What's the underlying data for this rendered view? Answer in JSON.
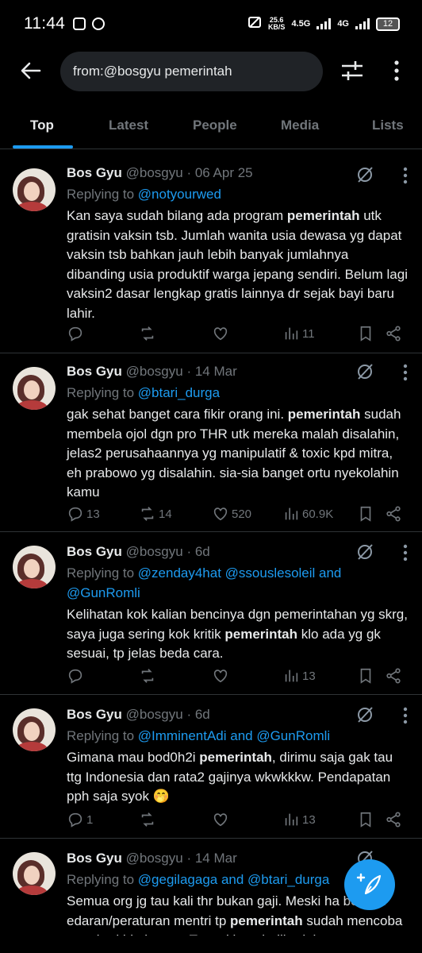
{
  "status_bar": {
    "time": "11:44",
    "net_speed_value": "25.6",
    "net_speed_unit": "KB/S",
    "net_label_1": "4.5G",
    "net_label_2": "4G",
    "battery": "12"
  },
  "header": {
    "search_query": "from:@bosgyu pemerintah"
  },
  "tabs": [
    {
      "label": "Top",
      "active": true
    },
    {
      "label": "Latest"
    },
    {
      "label": "People"
    },
    {
      "label": "Media"
    },
    {
      "label": "Lists"
    }
  ],
  "tweets": [
    {
      "name": "Bos Gyu",
      "handle": "@bosgyu",
      "date": "· 06 Apr 25",
      "reply_prefix": "Replying to ",
      "reply_to": "@notyourwed",
      "text_before": "Kan saya sudah bilang ada program ",
      "highlight": "pemerintah",
      "text_after": " utk gratisin vaksin tsb. Jumlah wanita usia dewasa yg dapat vaksin tsb bahkan jauh lebih banyak jumlahnya dibanding usia produktif warga jepang sendiri. Belum lagi vaksin2 dasar lengkap gratis lainnya dr sejak bayi baru lahir.",
      "replies": "",
      "retweets": "",
      "likes": "",
      "views": "11"
    },
    {
      "name": "Bos Gyu",
      "handle": "@bosgyu",
      "date": "· 14 Mar",
      "reply_prefix": "Replying to ",
      "reply_to": "@btari_durga",
      "text_before": "gak sehat banget cara fikir orang ini. ",
      "highlight": "pemerintah",
      "text_after": " sudah membela ojol dgn pro THR utk mereka malah disalahin, jelas2 perusahaannya yg manipulatif & toxic kpd mitra, eh prabowo yg disalahin. sia-sia banget ortu nyekolahin kamu",
      "replies": "13",
      "retweets": "14",
      "likes": "520",
      "views": "60.9K"
    },
    {
      "name": "Bos Gyu",
      "handle": "@bosgyu",
      "date": "· 6d",
      "reply_prefix": "Replying to ",
      "reply_to": "@zenday4hat @ssouslesoleil and @GunRomli",
      "text_before": "Kelihatan kok kalian bencinya dgn pemerintahan yg skrg, saya juga sering kok kritik ",
      "highlight": "pemerintah",
      "text_after": " klo ada yg gk sesuai, tp jelas beda cara.",
      "replies": "",
      "retweets": "",
      "likes": "",
      "views": "13"
    },
    {
      "name": "Bos Gyu",
      "handle": "@bosgyu",
      "date": "· 6d",
      "reply_prefix": "Replying to ",
      "reply_to": "@ImminentAdi and @GunRomli",
      "text_before": "Gimana mau bod0h2i ",
      "highlight": "pemerintah",
      "text_after": ", dirimu saja gak tau ttg Indonesia dan rata2 gajinya wkwkkkw. Pendapatan pph saja syok 🤭",
      "replies": "1",
      "retweets": "",
      "likes": "",
      "views": "13"
    },
    {
      "name": "Bos Gyu",
      "handle": "@bosgyu",
      "date": "· 14 Mar",
      "reply_prefix": "Replying to ",
      "reply_to": "@gegilagaga and @btari_durga",
      "text_before": "Semua org jg tau kali thr bukan gaji. Meski ha berupa edaran/peraturan mentri tp ",
      "highlight": "pemerintah",
      "text_after": " sudah mencoba memberi himbauan. Terus klo gak diberi thr",
      "replies": "",
      "retweets": "",
      "likes": "",
      "views": ""
    }
  ]
}
